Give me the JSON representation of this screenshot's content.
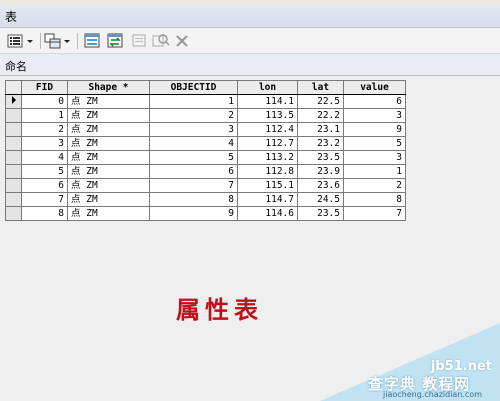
{
  "window": {
    "title": "表"
  },
  "toolbar": {
    "icons": [
      "table-options-icon",
      "related-tables-icon",
      "select-by-attributes-icon",
      "switch-selection-icon",
      "clear-selection-icon",
      "zoom-selected-icon",
      "delete-selected-icon"
    ]
  },
  "tab": {
    "label": "命名"
  },
  "table": {
    "columns": [
      "FID",
      "Shape *",
      "OBJECTID",
      "lon",
      "lat",
      "value"
    ],
    "rows": [
      [
        "0",
        "点 ZM",
        "1",
        "114.1",
        "22.5",
        "6"
      ],
      [
        "1",
        "点 ZM",
        "2",
        "113.5",
        "22.2",
        "3"
      ],
      [
        "2",
        "点 ZM",
        "3",
        "112.4",
        "23.1",
        "9"
      ],
      [
        "3",
        "点 ZM",
        "4",
        "112.7",
        "23.2",
        "5"
      ],
      [
        "4",
        "点 ZM",
        "5",
        "113.2",
        "23.5",
        "3"
      ],
      [
        "5",
        "点 ZM",
        "6",
        "112.8",
        "23.9",
        "1"
      ],
      [
        "6",
        "点 ZM",
        "7",
        "115.1",
        "23.6",
        "2"
      ],
      [
        "7",
        "点 ZM",
        "8",
        "114.7",
        "24.5",
        "8"
      ],
      [
        "8",
        "点 ZM",
        "9",
        "114.6",
        "23.5",
        "7"
      ]
    ]
  },
  "annotation": {
    "text": "属性表"
  },
  "watermark": {
    "site": "jb51.net",
    "name": "查字典 教程网",
    "url": "jiaocheng.chazidian.com"
  },
  "colors": {
    "annotation": "#c0101a",
    "watermark": "#b8dff2"
  }
}
